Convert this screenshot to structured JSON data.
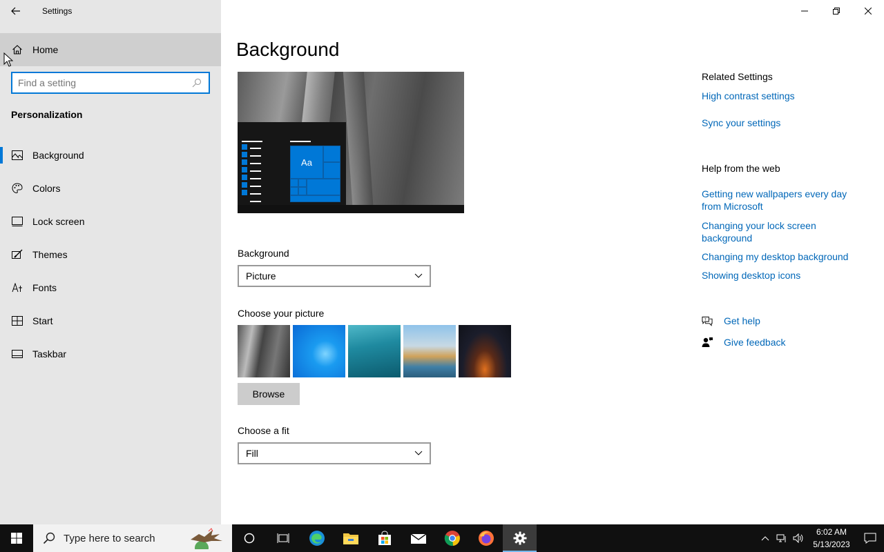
{
  "window": {
    "title": "Settings"
  },
  "sidebar": {
    "home_label": "Home",
    "search_placeholder": "Find a setting",
    "section_title": "Personalization",
    "items": [
      {
        "label": "Background",
        "icon": "picture-icon"
      },
      {
        "label": "Colors",
        "icon": "palette-icon"
      },
      {
        "label": "Lock screen",
        "icon": "lock-screen-icon"
      },
      {
        "label": "Themes",
        "icon": "themes-brush-icon"
      },
      {
        "label": "Fonts",
        "icon": "fonts-icon"
      },
      {
        "label": "Start",
        "icon": "start-icon"
      },
      {
        "label": "Taskbar",
        "icon": "taskbar-icon"
      }
    ],
    "active_item": "Background"
  },
  "main": {
    "page_title": "Background",
    "preview_tile_text": "Aa",
    "background_label": "Background",
    "background_value": "Picture",
    "choose_picture_label": "Choose your picture",
    "browse_label": "Browse",
    "choose_fit_label": "Choose a fit",
    "fit_value": "Fill"
  },
  "related": {
    "heading": "Related Settings",
    "links": [
      "High contrast settings",
      "Sync your settings"
    ]
  },
  "help_web": {
    "heading": "Help from the web",
    "links": [
      "Getting new wallpapers every day from Microsoft",
      "Changing your lock screen background",
      "Changing my desktop background",
      "Showing desktop icons"
    ]
  },
  "help_actions": {
    "get_help": "Get help",
    "give_feedback": "Give feedback"
  },
  "taskbar": {
    "search_placeholder": "Type here to search",
    "apps": [
      "cortana-icon",
      "task-view-icon",
      "edge-icon",
      "file-explorer-icon",
      "store-icon",
      "mail-icon",
      "chrome-icon",
      "firefox-icon",
      "settings-icon"
    ],
    "active_app": "settings-icon",
    "time": "6:02 AM",
    "date": "5/13/2023"
  },
  "colors": {
    "accent": "#0078d7",
    "link": "#0067b8",
    "sidebar_bg": "#e6e6e6",
    "taskbar_bg": "#101010"
  }
}
